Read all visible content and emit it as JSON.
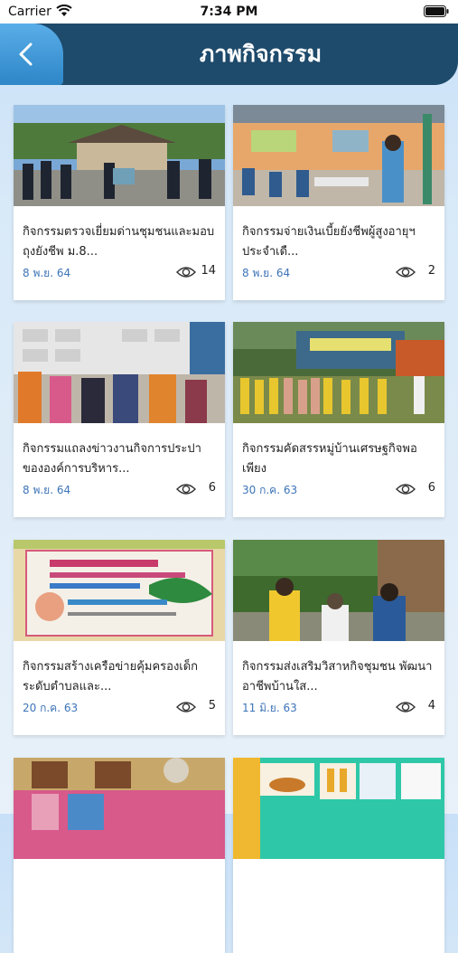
{
  "status_bar": {
    "carrier": "Carrier",
    "time": "7:34 PM"
  },
  "header": {
    "title": "ภาพกิจกรรม"
  },
  "activities": [
    {
      "title": "กิจกรรมตรวจเยี่ยมด่านชุมชนและมอบถุงยังชีพ ม.8...",
      "date": "8 พ.ย. 64",
      "views": "14"
    },
    {
      "title": "กิจกรรมจ่ายเงินเบี้ยยังชีพผู้สูงอายุฯ ประจำเดื...",
      "date": "8 พ.ย. 64",
      "views": "2"
    },
    {
      "title": "กิจกรรมแถลงข่าวงานกิจการประปาขององค์การบริหาร...",
      "date": "8 พ.ย. 64",
      "views": "6"
    },
    {
      "title": "กิจกรรมคัดสรรหมู่บ้านเศรษฐกิจพอเพียง",
      "date": "30 ก.ค. 63",
      "views": "6"
    },
    {
      "title": "กิจกรรมสร้างเครือข่ายคุ้มครองเด็กระดับตำบลและ...",
      "date": "20 ก.ค. 63",
      "views": "5"
    },
    {
      "title": "กิจกรรมส่งเสริมวิสาหกิจชุมชน พัฒนาอาชีพบ้านใส...",
      "date": "11 มิ.ย. 63",
      "views": "4"
    },
    {
      "title": "",
      "date": "",
      "views": ""
    },
    {
      "title": "",
      "date": "",
      "views": ""
    }
  ]
}
